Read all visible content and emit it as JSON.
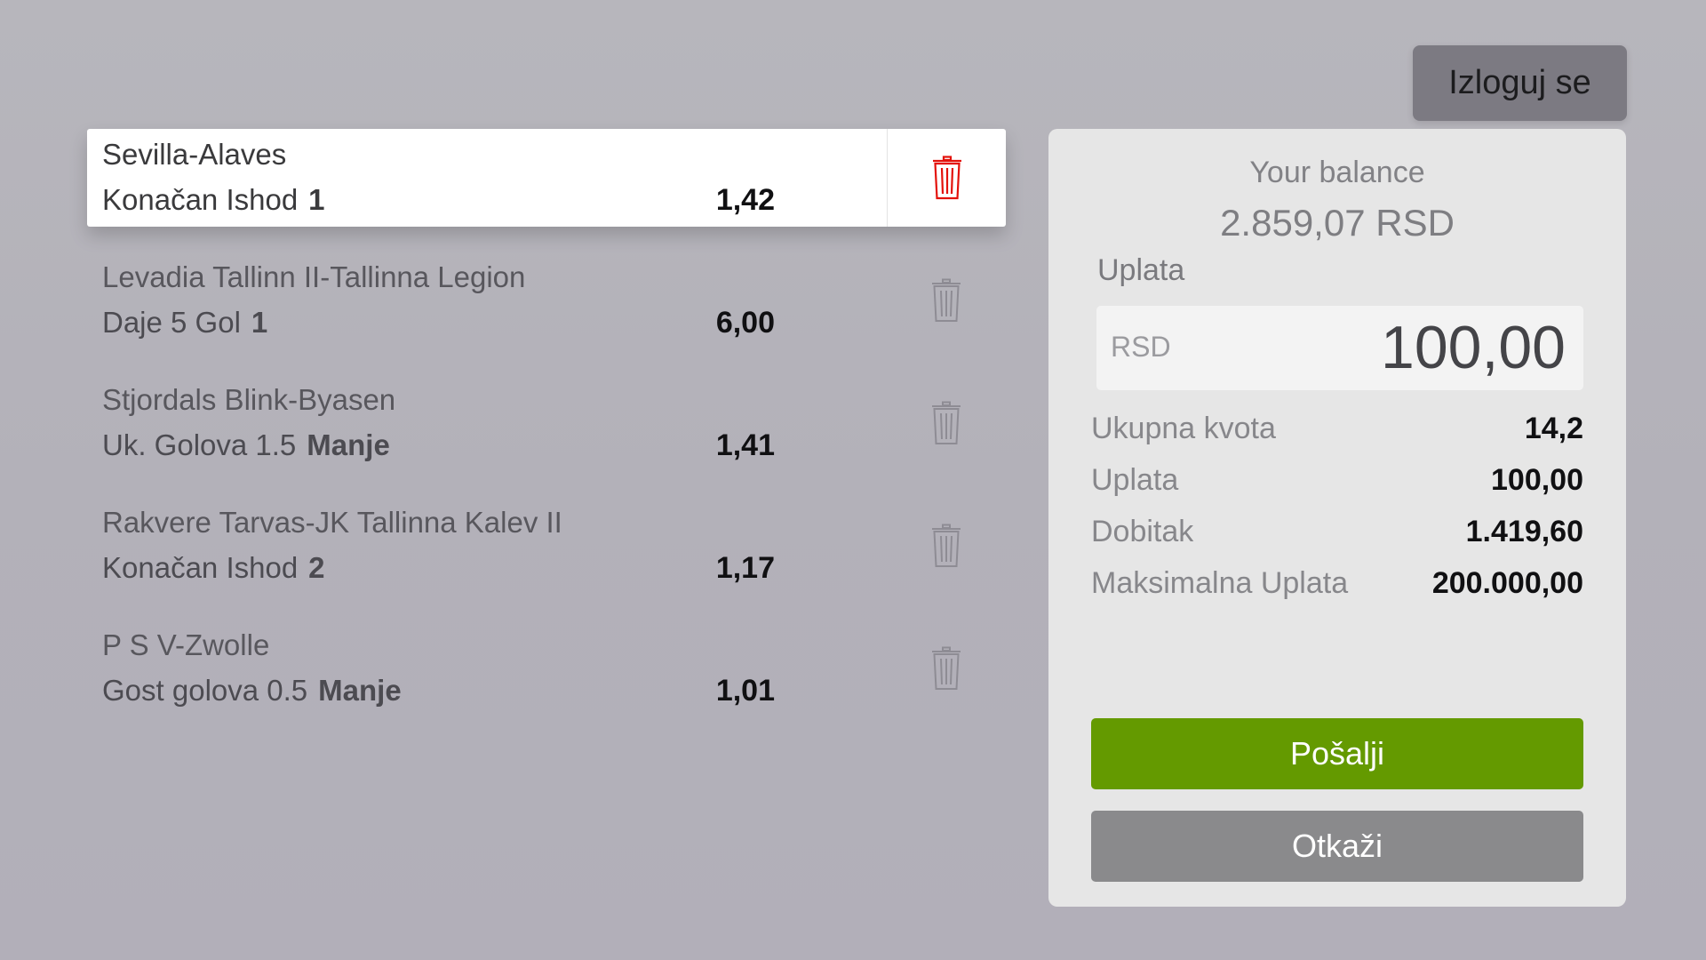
{
  "header": {
    "logout_label": "Izloguj se"
  },
  "bets": [
    {
      "match": "Sevilla-Alaves",
      "market": "Konačan Ishod",
      "pick": "1",
      "odd": "1,42",
      "selected": true
    },
    {
      "match": "Levadia Tallinn II-Tallinna Legion",
      "market": "Daje 5 Gol",
      "pick": "1",
      "odd": "6,00",
      "selected": false
    },
    {
      "match": "Stjordals Blink-Byasen",
      "market": "Uk. Golova 1.5",
      "pick": "Manje",
      "odd": "1,41",
      "selected": false
    },
    {
      "match": "Rakvere Tarvas-JK Tallinna Kalev II",
      "market": "Konačan Ishod",
      "pick": "2",
      "odd": "1,17",
      "selected": false
    },
    {
      "match": "P S V-Zwolle",
      "market": "Gost golova 0.5",
      "pick": "Manje",
      "odd": "1,01",
      "selected": false
    }
  ],
  "panel": {
    "balance_label": "Your balance",
    "balance_value": "2.859,07 RSD",
    "stake_label": "Uplata",
    "stake_currency": "RSD",
    "stake_amount": "100,00",
    "summary": [
      {
        "label": "Ukupna kvota",
        "value": "14,2"
      },
      {
        "label": "Uplata",
        "value": "100,00"
      },
      {
        "label": "Dobitak",
        "value": "1.419,60"
      },
      {
        "label": "Maksimalna Uplata",
        "value": "200.000,00"
      }
    ],
    "send_label": "Pošalji",
    "cancel_label": "Otkaži"
  },
  "icons": {
    "delete": "trash-icon"
  },
  "colors": {
    "trash_active": "#e3120b",
    "trash_inactive": "#8e8c94",
    "send_button": "#649a00",
    "cancel_button": "#8a8a8c"
  }
}
